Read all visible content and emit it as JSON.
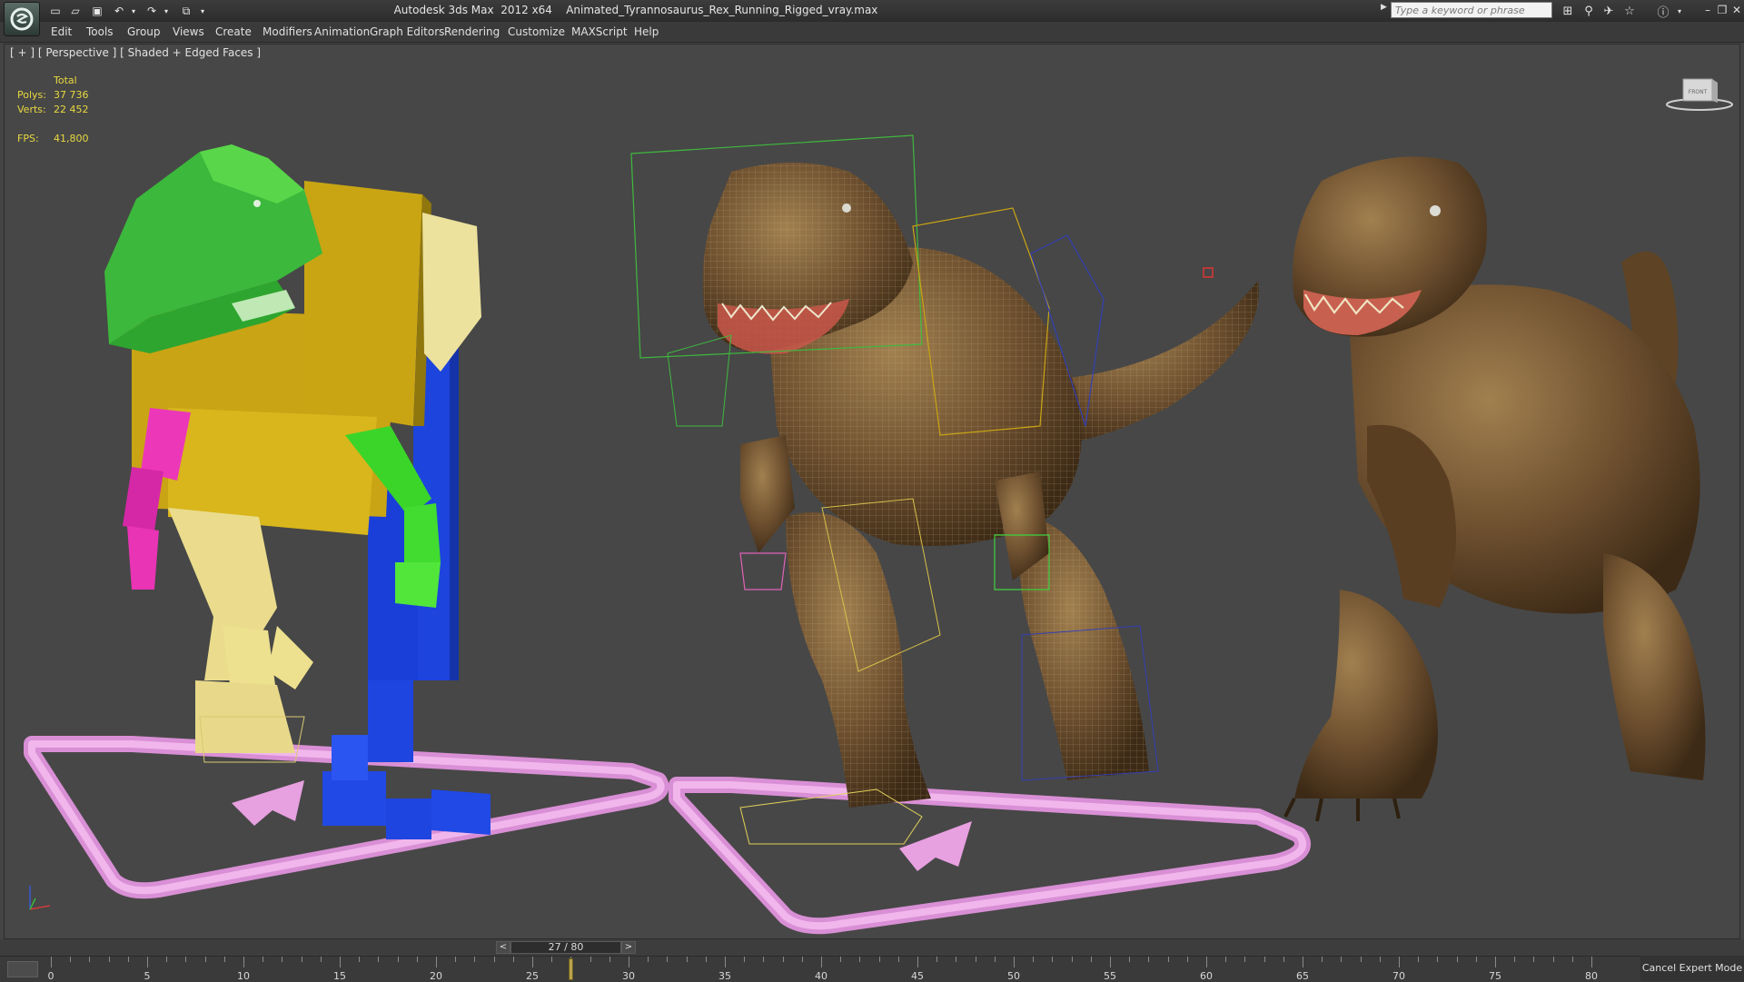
{
  "window": {
    "app_title": "Autodesk 3ds Max  2012 x64",
    "file_name": "Animated_Tyrannosaurus_Rex_Running_Rigged_vray.max",
    "search_placeholder": "Type a keyword or phrase"
  },
  "menu": {
    "items": [
      "Edit",
      "Tools",
      "Group",
      "Views",
      "Create",
      "Modifiers",
      "Animation",
      "Graph Editors",
      "Rendering",
      "Customize",
      "MAXScript",
      "Help"
    ]
  },
  "viewport": {
    "label": "[ + ] [ Perspective ] [ Shaded + Edged Faces ]",
    "stats": {
      "total_label": "Total",
      "polys_label": "Polys:",
      "polys_value": "37 736",
      "verts_label": "Verts:",
      "verts_value": "22 452",
      "fps_label": "FPS:",
      "fps_value": "41,800"
    },
    "viewcube_label": "FRONT"
  },
  "timeline": {
    "frame_display": "27 / 80",
    "prev": "<",
    "next": ">",
    "current_frame": 27,
    "total_frames": 80,
    "tick_labels": [
      "0",
      "5",
      "10",
      "15",
      "20",
      "25",
      "30",
      "35",
      "40",
      "45",
      "50",
      "55",
      "60",
      "65",
      "70",
      "75",
      "80"
    ]
  },
  "status": {
    "cancel_expert_mode": "Cancel Expert Mode"
  },
  "colors": {
    "viewport_bg": "#474747",
    "stats_text": "#e8d840",
    "biped_head": "#3cb83c",
    "biped_torso": "#c8a814",
    "biped_right": "#1a3fd8",
    "biped_left_arm": "#e62fb4",
    "biped_leg_left": "#e8d98a",
    "footstep_path": "#e7a0e0",
    "dino_skin": "#7a5a35"
  }
}
